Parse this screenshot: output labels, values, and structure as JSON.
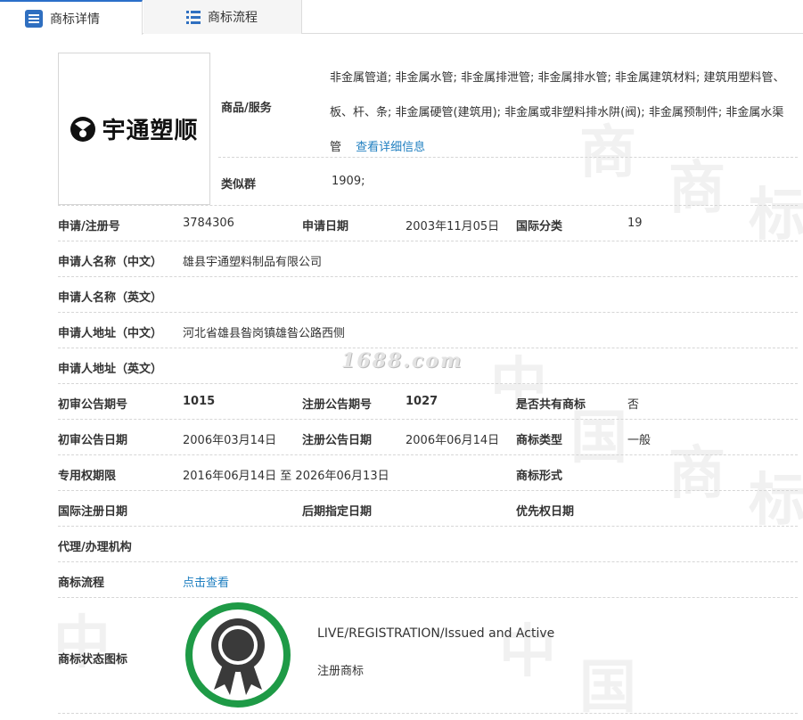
{
  "tabs": [
    {
      "label": "商标详情",
      "active": true
    },
    {
      "label": "商标流程",
      "active": false
    }
  ],
  "logo": {
    "text": "宇通塑顺"
  },
  "goods": {
    "label": "商品/服务",
    "value": "非金属管道; 非金属水管; 非金属排泄管; 非金属排水管; 非金属建筑材料; 建筑用塑料管、板、杆、条; 非金属硬管(建筑用); 非金属或非塑料排水阱(阀); 非金属预制件; 非金属水渠管",
    "link": "查看详细信息"
  },
  "similar": {
    "label": "类似群",
    "value": "1909;"
  },
  "fields": {
    "reg_no": {
      "label": "申请/注册号",
      "value": "3784306"
    },
    "apply_date": {
      "label": "申请日期",
      "value": "2003年11月05日"
    },
    "intl_class": {
      "label": "国际分类",
      "value": "19"
    },
    "applicant_cn": {
      "label": "申请人名称（中文）",
      "value": "雄县宇通塑料制品有限公司"
    },
    "applicant_en": {
      "label": "申请人名称（英文）",
      "value": ""
    },
    "address_cn": {
      "label": "申请人地址（中文）",
      "value": "河北省雄县昝岗镇雄昝公路西侧"
    },
    "address_en": {
      "label": "申请人地址（英文）",
      "value": ""
    },
    "prelim_issue_no": {
      "label": "初审公告期号",
      "value": "1015"
    },
    "reg_issue_no": {
      "label": "注册公告期号",
      "value": "1027"
    },
    "shared": {
      "label": "是否共有商标",
      "value": "否"
    },
    "prelim_date": {
      "label": "初审公告日期",
      "value": "2006年03月14日"
    },
    "reg_date": {
      "label": "注册公告日期",
      "value": "2006年06月14日"
    },
    "tm_type": {
      "label": "商标类型",
      "value": "一般"
    },
    "exclusive_period": {
      "label": "专用权期限",
      "value": "2016年06月14日 至 2026年06月13日"
    },
    "tm_form": {
      "label": "商标形式",
      "value": ""
    },
    "intl_reg_date": {
      "label": "国际注册日期",
      "value": ""
    },
    "later_designation": {
      "label": "后期指定日期",
      "value": ""
    },
    "priority_date": {
      "label": "优先权日期",
      "value": ""
    },
    "agent": {
      "label": "代理/办理机构",
      "value": ""
    },
    "flow": {
      "label": "商标流程",
      "link": "点击查看"
    },
    "status_icon": {
      "label": "商标状态图标"
    }
  },
  "status": {
    "line1": "LIVE/REGISTRATION/Issued and Active",
    "line2": "注册商标"
  },
  "watermark": {
    "site": "1688.com"
  },
  "colors": {
    "accent": "#2f6fc0",
    "link": "#1f7fc0",
    "status_green": "#1e9a46",
    "ribbon": "#3a3a3a"
  }
}
